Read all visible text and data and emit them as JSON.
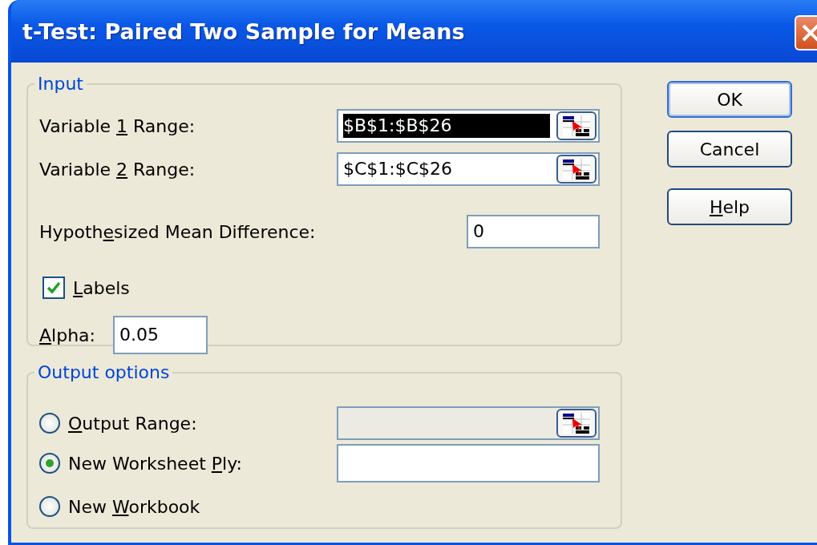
{
  "window": {
    "title": "t-Test: Paired Two Sample for Means"
  },
  "input": {
    "legend": "Input",
    "ranges": [
      {
        "label": {
          "pre": "Variable ",
          "key": "1",
          "post": " Range:"
        },
        "value": "$B$1:$B$26",
        "selected": true
      },
      {
        "label": {
          "pre": "Variable ",
          "key": "2",
          "post": " Range:"
        },
        "value": "$C$1:$C$26",
        "selected": false
      }
    ],
    "mean_difference": {
      "label": {
        "pre": "Hypoth",
        "key": "e",
        "post": "sized Mean Difference:"
      },
      "value": "0"
    },
    "labels": {
      "label": {
        "key": "L",
        "post": "abels"
      },
      "checked": true
    },
    "alpha": {
      "label": {
        "key": "A",
        "post": "lpha:"
      },
      "value": "0.05"
    }
  },
  "output": {
    "legend": "Output options",
    "options": [
      {
        "kind": "range",
        "label": {
          "key": "O",
          "post": "utput Range:"
        },
        "selected": false,
        "disabled": true
      },
      {
        "kind": "field",
        "label": {
          "pre": "New Worksheet ",
          "key": "P",
          "post": "ly:"
        },
        "selected": true
      },
      {
        "kind": "plain",
        "label": {
          "pre": "New ",
          "key": "W",
          "post": "orkbook"
        },
        "selected": false
      }
    ]
  },
  "buttons": [
    {
      "label": {
        "pre": "OK"
      },
      "default": true
    },
    {
      "label": {
        "pre": "Cancel"
      },
      "default": false
    },
    {
      "label": {
        "key": "H",
        "post": "elp"
      },
      "default": false
    }
  ]
}
